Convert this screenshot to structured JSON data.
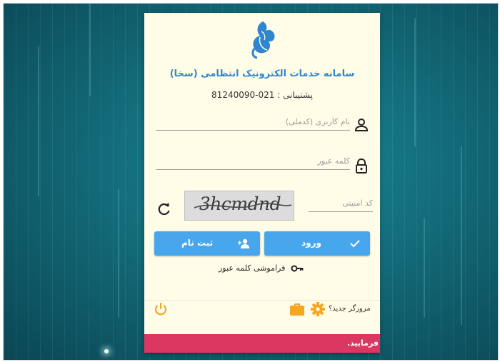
{
  "app": {
    "title": "سامانه خدمات الکترونیک انتظامی (سخا)",
    "support_text": "پشتیبانی : 021-81240090"
  },
  "form": {
    "username_placeholder": "نام کاربری (کدملی)",
    "password_placeholder": "کلمه عبور",
    "captcha_placeholder": "کد امنیتی",
    "captcha_text": "3hcmdnd"
  },
  "buttons": {
    "login_label": "ورود",
    "register_label": "ثبت نام",
    "forgot_password_label": "فراموشی کلمه عبور"
  },
  "footer": {
    "new_browser_label": "مرورگر جدید؟",
    "notice_text": "فرمایید."
  },
  "colors": {
    "accent": "#47a6ec",
    "title": "#2f86cf",
    "card_bg": "#fffde8",
    "notice_bar": "#dc3760",
    "icon_orange": "#f5a623"
  },
  "icons": {
    "logo": "seahorse-logo-icon",
    "username": "user-icon",
    "password": "lock-icon",
    "refresh": "refresh-icon",
    "login": "check-icon",
    "register": "add-user-icon",
    "forgot": "key-icon",
    "power": "power-icon",
    "settings": "gear-icon",
    "briefcase": "briefcase-icon"
  }
}
